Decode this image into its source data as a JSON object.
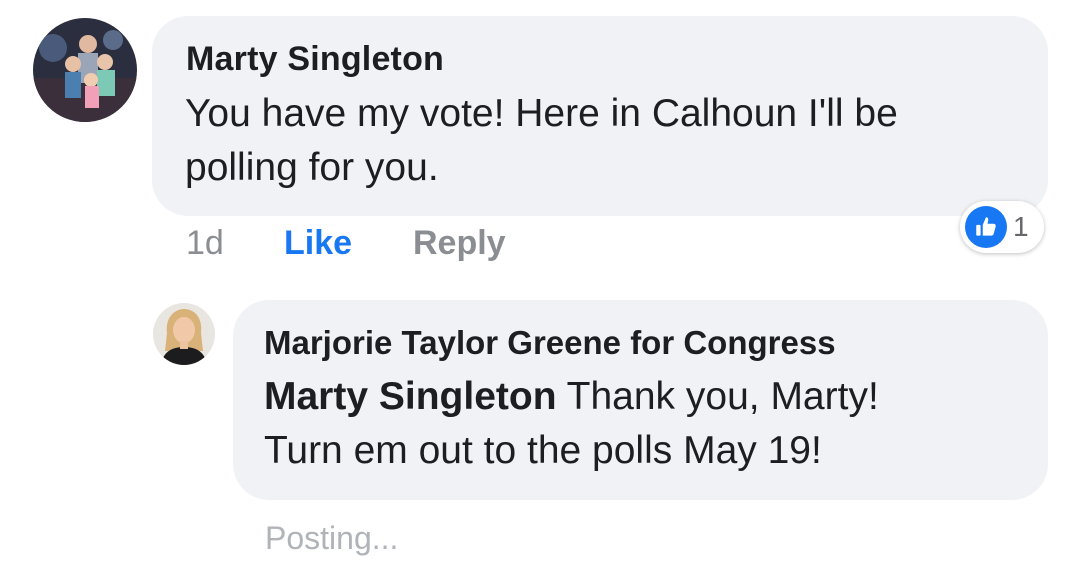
{
  "comment": {
    "author": "Marty Singleton",
    "text_line1": "You have my vote! Here in Calhoun I'll be",
    "text_line2": "polling for you.",
    "timestamp": "1d",
    "like_label": "Like",
    "reply_label": "Reply",
    "reaction_icon": "like-thumb-icon",
    "reaction_count": "1"
  },
  "reply": {
    "author": "Marjorie Taylor Greene for Congress",
    "mention": "Marty Singleton",
    "text_line1_rest": " Thank you, Marty!",
    "text_line2": "Turn em out to the polls May 19!",
    "status": "Posting..."
  },
  "colors": {
    "bubble": "#f0f2f5",
    "like_blue": "#1877f2",
    "meta_gray": "#8a8d91"
  }
}
